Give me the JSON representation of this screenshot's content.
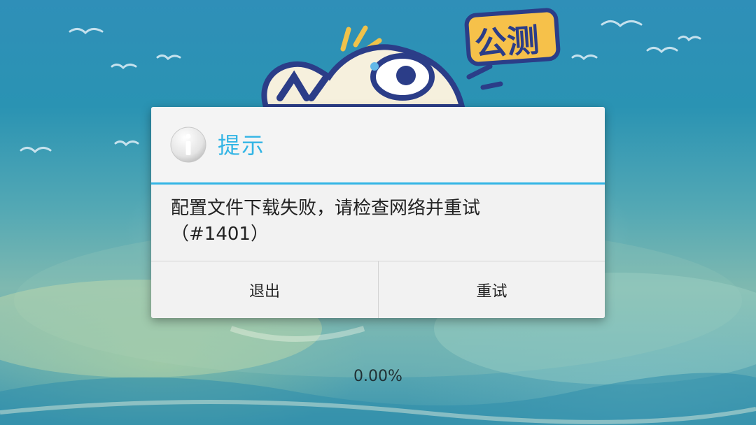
{
  "background": {
    "logo_badge": "公测"
  },
  "dialog": {
    "title": "提示",
    "icon": "info-icon",
    "message": "配置文件下载失败，请检查网络并重试\n（#1401）",
    "buttons": {
      "exit_label": "退出",
      "retry_label": "重试"
    },
    "accent_color": "#33b5e5"
  },
  "loading": {
    "progress_text": "0.00%"
  }
}
